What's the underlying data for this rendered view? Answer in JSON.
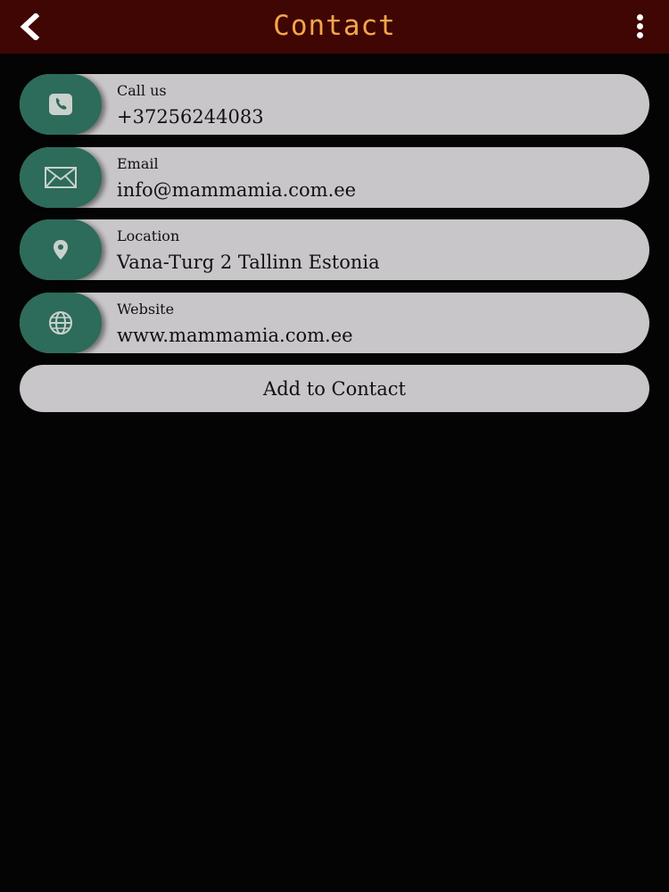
{
  "header": {
    "title": "Contact",
    "back_icon": "chevron-left-icon",
    "menu_icon": "more-vertical-icon"
  },
  "contacts": [
    {
      "icon": "phone-icon",
      "label": "Call us",
      "value": "+37256244083"
    },
    {
      "icon": "mail-icon",
      "label": "Email",
      "value": "info@mammamia.com.ee"
    },
    {
      "icon": "location-pin-icon",
      "label": "Location",
      "value": "Vana-Turg 2 Tallinn Estonia"
    },
    {
      "icon": "globe-icon",
      "label": "Website",
      "value": "www.mammamia.com.ee"
    }
  ],
  "add_button": {
    "label": "Add to Contact"
  },
  "colors": {
    "app_bar": "#3f0604",
    "title": "#f4a64a",
    "background": "#040405",
    "row": "#c8c6c8",
    "icon_circle": "#2d6b5a"
  }
}
